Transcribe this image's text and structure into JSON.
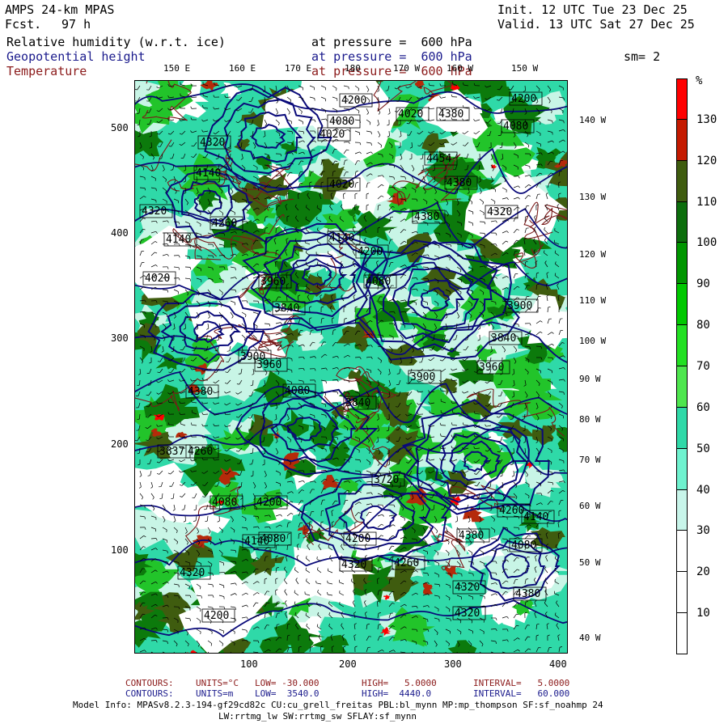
{
  "header": {
    "model": "AMPS 24-km MPAS",
    "fcst_label": "Fcst.",
    "fcst_value": "97 h",
    "init": "Init. 12 UTC Tue 23 Dec 25",
    "valid": "Valid. 13 UTC Sat 27 Dec 25",
    "fields": [
      {
        "name": "Relative humidity (w.r.t. ice)",
        "level": "at pressure =  600 hPa",
        "color": "#000000"
      },
      {
        "name": "Geopotential height",
        "level": "at pressure =  600 hPa",
        "color": "#1a1a8c"
      },
      {
        "name": "Temperature",
        "level": "at pressure =  600 hPa",
        "color": "#8b1a1a"
      }
    ],
    "smoothing": "sm= 2"
  },
  "map": {
    "x_ticks": [
      "100",
      "200",
      "300",
      "400"
    ],
    "y_ticks": [
      "100",
      "200",
      "300",
      "400",
      "500"
    ],
    "top_lon_labels": [
      "150 E",
      "160 E",
      "170 E",
      "180",
      "170 W",
      "160 W",
      "150 W"
    ],
    "right_lon_labels": [
      "140 W",
      "130 W",
      "120 W",
      "110 W",
      "100 W",
      "90 W",
      "80 W",
      "70 W",
      "60 W",
      "50 W",
      "40 W"
    ],
    "height_labels": [
      "4320",
      "4140",
      "4260",
      "4320",
      "4140",
      "4020",
      "4080",
      "4020",
      "4200",
      "4380",
      "4454",
      "4380",
      "4320",
      "4080",
      "4200",
      "4380",
      "4140",
      "4020",
      "4080",
      "4200",
      "3960",
      "3840",
      "3900",
      "3960",
      "4080",
      "3840",
      "3900",
      "3960",
      "3840",
      "3900",
      "3720",
      "3837",
      "4020",
      "4080",
      "4140",
      "4080",
      "4200",
      "4260",
      "4320",
      "4380",
      "4140",
      "4080",
      "4260",
      "4380",
      "4320",
      "4200",
      "4320",
      "4200",
      "4320",
      "4260",
      "4380"
    ],
    "rh_palette": {
      "white": "#ffffff",
      "light": "#c8f5e6",
      "mid": "#2fd9a8",
      "green": "#22c42a",
      "dark": "#0c7a0c",
      "olive": "#3f5c0f",
      "brown": "#b52a0a",
      "red": "#ff0000"
    },
    "contour_colors": {
      "height": "#0a0a7a",
      "temperature": "#7a1a1a"
    }
  },
  "colorbar": {
    "unit": "%",
    "labels": [
      "130",
      "120",
      "110",
      "100",
      "90",
      "80",
      "70",
      "60",
      "50",
      "40",
      "30",
      "20",
      "10"
    ],
    "colors": [
      "#ff0000",
      "#c41a00",
      "#3f5c0f",
      "#0c6e0c",
      "#009600",
      "#00c800",
      "#22e022",
      "#4ee64e",
      "#2fd9a8",
      "#6ff2cf",
      "#c8f5ea",
      "#ffffff",
      "#ffffff",
      "#ffffff"
    ]
  },
  "footer": {
    "temp_contours": {
      "label": "CONTOURS:",
      "units": "UNITS=°C",
      "low": "LOW= -30.000",
      "high": "HIGH=   5.0000",
      "interval": "INTERVAL=   5.0000"
    },
    "height_contours": {
      "label": "CONTOURS:",
      "units": "UNITS=m",
      "low": "LOW=  3540.0",
      "high": "HIGH=  4440.0",
      "interval": "INTERVAL=   60.000"
    },
    "model_info_1": "Model Info: MPASv8.2.3-194-gf29cd82c CU:cu_grell_freitas PBL:bl_mynn MP:mp_thompson SF:sf_noahmp 24",
    "model_info_2": "LW:rrtmg_lw SW:rrtmg_sw SFLAY:sf_mynn"
  }
}
